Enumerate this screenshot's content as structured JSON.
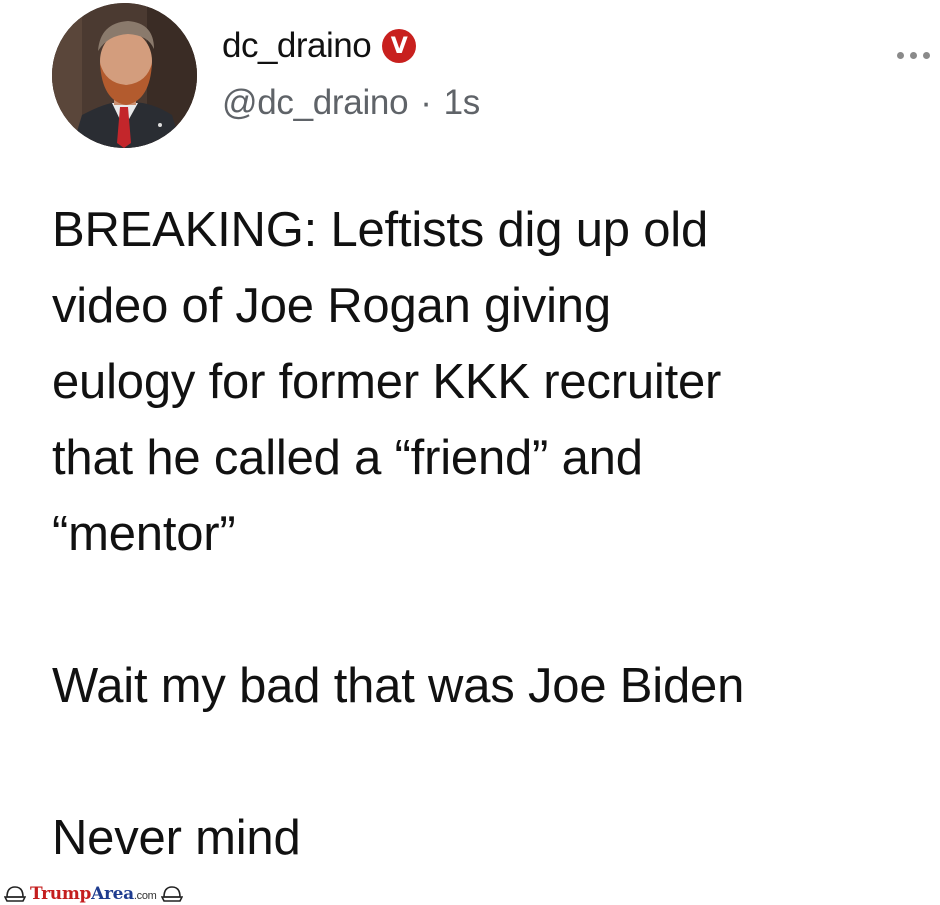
{
  "post": {
    "display_name": "dc_draino",
    "verified_badge": "V",
    "handle": "@dc_draino",
    "separator": "·",
    "timestamp": "1s",
    "more_icon": "more-horizontal-icon",
    "text_lines": [
      "BREAKING: Leftists dig up old",
      "video of Joe Rogan giving",
      "eulogy for former KKK recruiter",
      "that he called a “friend” and",
      "“mentor”"
    ],
    "line_2": "Wait my bad that was Joe Biden",
    "line_3": "Never mind"
  },
  "watermark": {
    "brand_part1": "Trump",
    "brand_part2": "Area",
    "brand_tld": ".com"
  },
  "colors": {
    "verified_badge": "#c8201e",
    "handle": "#5f6368",
    "watermark_red": "#c41e1e",
    "watermark_blue": "#1f3c8f"
  }
}
